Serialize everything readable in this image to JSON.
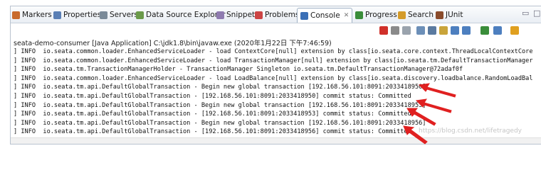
{
  "tabs": [
    {
      "label": "Markers",
      "icon": "markers-icon",
      "color": "#c96b2c"
    },
    {
      "label": "Properties",
      "icon": "properties-icon",
      "color": "#5a7fb5"
    },
    {
      "label": "Servers",
      "icon": "servers-icon",
      "color": "#7a8a99"
    },
    {
      "label": "Data Source Explorer",
      "icon": "database-icon",
      "color": "#6b9a4a"
    },
    {
      "label": "Snippets",
      "icon": "snippets-icon",
      "color": "#8f7bb0"
    },
    {
      "label": "Problems",
      "icon": "problems-icon",
      "color": "#c44"
    },
    {
      "label": "Console",
      "icon": "console-icon",
      "color": "#3b6fb6",
      "active": true
    },
    {
      "label": "Progress",
      "icon": "progress-icon",
      "color": "#3a8d3a"
    },
    {
      "label": "Search",
      "icon": "search-icon",
      "color": "#d49b2a"
    },
    {
      "label": "JUnit",
      "icon": "junit-icon",
      "color": "#8a4b2b"
    }
  ],
  "console": {
    "title": "seata-demo-consumer [Java Application] C:\\jdk1.8\\bin\\javaw.exe (2020年1月22日 下午7:46:59)",
    "lines": [
      "] INFO  io.seata.common.loader.EnhancedServiceLoader - load ContextCore[null] extension by class[io.seata.core.context.ThreadLocalContextCore",
      "] INFO  io.seata.common.loader.EnhancedServiceLoader - load TransactionManager[null] extension by class[io.seata.tm.DefaultTransactionManager",
      "] INFO  io.seata.tm.TransactionManagerHolder - TransactionManager Singleton io.seata.tm.DefaultTransactionManager@72adaf0f",
      "] INFO  io.seata.common.loader.EnhancedServiceLoader - load LoadBalance[null] extension by class[io.seata.discovery.loadbalance.RandomLoadBal",
      "] INFO  io.seata.tm.api.DefaultGlobalTransaction - Begin new global transaction [192.168.56.101:8091:2033418950]",
      "] INFO  io.seata.tm.api.DefaultGlobalTransaction - [192.168.56.101:8091:2033418950] commit status: Committed",
      "] INFO  io.seata.tm.api.DefaultGlobalTransaction - Begin new global transaction [192.168.56.101:8091:2033418953]",
      "] INFO  io.seata.tm.api.DefaultGlobalTransaction - [192.168.56.101:8091:2033418953] commit status: Committed",
      "] INFO  io.seata.tm.api.DefaultGlobalTransaction - Begin new global transaction [192.168.56.101:8091:2033418956]",
      "] INFO  io.seata.tm.api.DefaultGlobalTransaction - [192.168.56.101:8091:2033418956] commit status: Committed"
    ]
  },
  "toolbar_icons": [
    {
      "name": "terminate-icon",
      "color": "#d0302a"
    },
    {
      "name": "remove-launch-icon",
      "color": "#8a8a8a"
    },
    {
      "name": "remove-all-icon",
      "color": "#9aa3ad"
    },
    {
      "name": "clear-console-icon",
      "color": "#6c8fb8"
    },
    {
      "name": "scroll-lock-icon",
      "color": "#5a7aa0"
    },
    {
      "name": "word-wrap-icon",
      "color": "#c9a43a"
    },
    {
      "name": "show-on-output-icon",
      "color": "#4d7fbf"
    },
    {
      "name": "show-on-error-icon",
      "color": "#4d7fbf"
    },
    {
      "name": "pin-console-icon",
      "color": "#3a8d3a"
    },
    {
      "name": "display-console-icon",
      "color": "#4d7fbf"
    },
    {
      "name": "open-console-icon",
      "color": "#e0a020"
    }
  ],
  "watermark": "https://blog.csdn.net/lifetragedy",
  "colors": {
    "arrow": "#e02020",
    "tab_active_border": "#9fb0c4"
  }
}
